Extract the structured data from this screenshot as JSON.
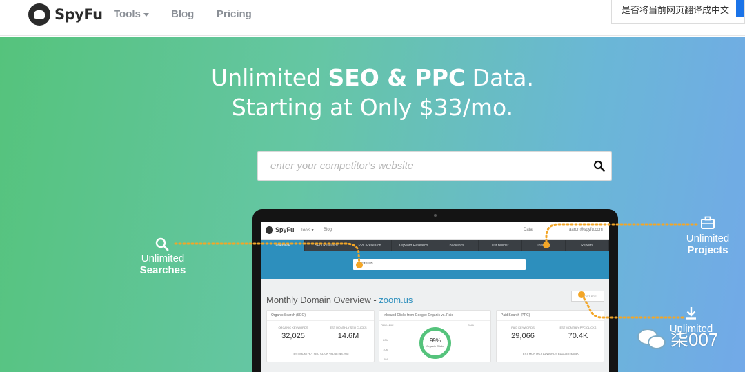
{
  "nav": {
    "logo": "SpyFu",
    "tools": "Tools",
    "blog": "Blog",
    "pricing": "Pricing"
  },
  "translate_bar": "是否将当前网页翻译成中文",
  "hero": {
    "line1_pre": "Unlimited ",
    "line1_bold": "SEO & PPC",
    "line1_post": " Data.",
    "line2": "Starting at Only $33/mo.",
    "search_placeholder": "enter your competitor's website"
  },
  "callouts": {
    "search_1": "Unlimited",
    "search_2": "Searches",
    "projects_1": "Unlimited",
    "projects_2": "Projects",
    "export_1": "Unlimited"
  },
  "laptop": {
    "logo": "SpyFu",
    "nav_tools": "Tools ▾",
    "nav_blog": "Blog",
    "nav_data": "Data:",
    "nav_user": "aaron@spyfu.com",
    "tabs": [
      "Overview",
      "SEO Research",
      "PPC Research",
      "Keyword Research",
      "Backlinks",
      "List Builder",
      "Tracking",
      "Reports"
    ],
    "search_value": "zoom.us",
    "title_pre": "Monthly Domain Overview - ",
    "title_link": "zoom.us",
    "export": "EXPORT PDF",
    "card1": {
      "title": "Organic Search (SEO)",
      "k1_label": "ORGANIC KEYWORDS",
      "k1_value": "32,025",
      "k2_label": "EST MONTHLY SEO CLICKS",
      "k2_value": "14.6M",
      "footer": "EST MONTHLY SEO CLICK VALUE: $8.29M"
    },
    "card2": {
      "title": "Inbound Clicks from Google: Organic vs. Paid",
      "legend_a": "ORGANIC",
      "legend_b": "PAID",
      "ring_value": "99%",
      "ring_label": "Organic Clicks",
      "axis": [
        "20M",
        "10M",
        "5M"
      ]
    },
    "card3": {
      "title": "Paid Search (PPC)",
      "k1_label": "PAID KEYWORDS",
      "k1_value": "29,066",
      "k2_label": "EST MONTHLY PPC CLICKS",
      "k2_value": "70.4K",
      "footer": "EST MONTHLY ADWORDS BUDGET: $355K"
    }
  },
  "watermark": "柒007",
  "colors": {
    "hero_green": "#55c37c",
    "hero_blue": "#72a9e8",
    "accent_orange": "#f3a627",
    "spyfu_blue": "#2d8fbd"
  }
}
